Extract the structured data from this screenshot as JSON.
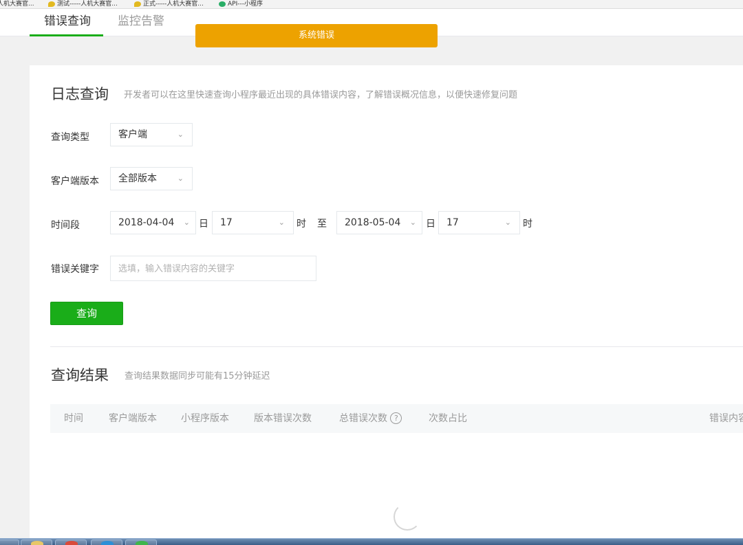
{
  "bookmarks": [
    {
      "label": "人机大赛官..."
    },
    {
      "label": "测试-----人机大赛官..."
    },
    {
      "label": "正式-----人机大赛官..."
    },
    {
      "label": "API---小程序"
    }
  ],
  "tabs": [
    {
      "label": "错误查询"
    },
    {
      "label": "监控告警"
    }
  ],
  "toast": "系统错误",
  "log_query": {
    "title": "日志查询",
    "description": "开发者可以在这里快速查询小程序最近出现的具体错误内容，了解错误概况信息，以便快速修复问题",
    "query_type_label": "查询类型",
    "query_type_value": "客户端",
    "client_version_label": "客户端版本",
    "client_version_value": "全部版本",
    "time_range_label": "时间段",
    "start_date": "2018-04-04",
    "day_unit": "日",
    "start_hour": "17",
    "hour_unit": "时",
    "to_label": "至",
    "end_date": "2018-05-04",
    "end_hour": "17",
    "keyword_label": "错误关键字",
    "keyword_placeholder": "选填，输入错误内容的关键字",
    "query_button": "查询"
  },
  "results": {
    "title": "查询结果",
    "description": "查询结果数据同步可能有15分钟延迟",
    "columns": [
      "时间",
      "客户端版本",
      "小程序版本",
      "版本错误次数",
      "总错误次数",
      "次数占比",
      "错误内容"
    ],
    "help_icon": "?"
  },
  "colors": {
    "accent": "#1aad19",
    "toast": "#eda200",
    "muted": "#9a9a9a"
  }
}
